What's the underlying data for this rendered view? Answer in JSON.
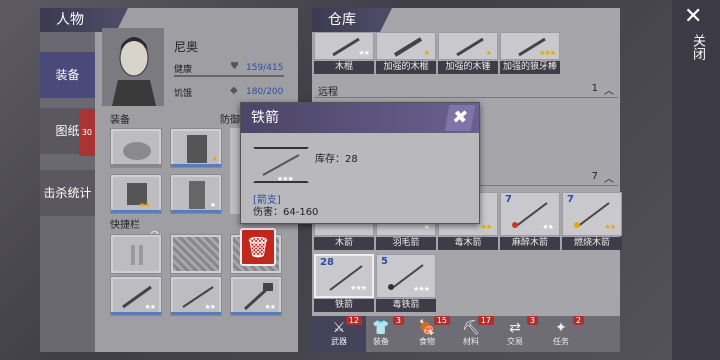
{
  "character": {
    "title": "人物",
    "name": "尼奥",
    "health_label": "健康",
    "health_value": "159/415",
    "hunger_label": "饥饿",
    "hunger_value": "180/200",
    "equip_label": "装备",
    "defense_label": "防御",
    "quickbar_label": "快捷栏"
  },
  "sidebar": {
    "items": [
      {
        "label": "装备"
      },
      {
        "label": "图纸",
        "badge": "30"
      },
      {
        "label": "击杀统计"
      }
    ]
  },
  "warehouse": {
    "title": "仓库",
    "top_items": [
      {
        "label": "木棍",
        "stars": "★★"
      },
      {
        "label": "加强的木棍",
        "stars": "★"
      },
      {
        "label": "加强的木锤",
        "stars": "★"
      },
      {
        "label": "加强的狼牙棒",
        "stars": "★★★"
      }
    ],
    "section_ranged": {
      "label": "远程",
      "count": "1"
    },
    "section_arrows": {
      "count": "7"
    },
    "arrows_row1": [
      {
        "label": "木箭",
        "count": ""
      },
      {
        "label": "羽毛箭",
        "count": ""
      },
      {
        "label": "毒木箭",
        "count": ""
      },
      {
        "label": "麻醉木箭",
        "count": "7"
      },
      {
        "label": "燃烧木箭",
        "count": "7"
      }
    ],
    "arrows_row2": [
      {
        "label": "铁箭",
        "count": "28"
      },
      {
        "label": "毒铁箭",
        "count": "5"
      }
    ]
  },
  "popup": {
    "title": "铁箭",
    "stock_label": "库存：28",
    "category": "[箭支]",
    "damage": "伤害：64-160"
  },
  "bottom_tabs": [
    {
      "label": "武器",
      "badge": "12"
    },
    {
      "label": "装备",
      "badge": "3"
    },
    {
      "label": "食物",
      "badge": "15"
    },
    {
      "label": "材料",
      "badge": "17"
    },
    {
      "label": "交易",
      "badge": "3"
    },
    {
      "label": "任务",
      "badge": "2"
    }
  ],
  "close_label": "关闭"
}
